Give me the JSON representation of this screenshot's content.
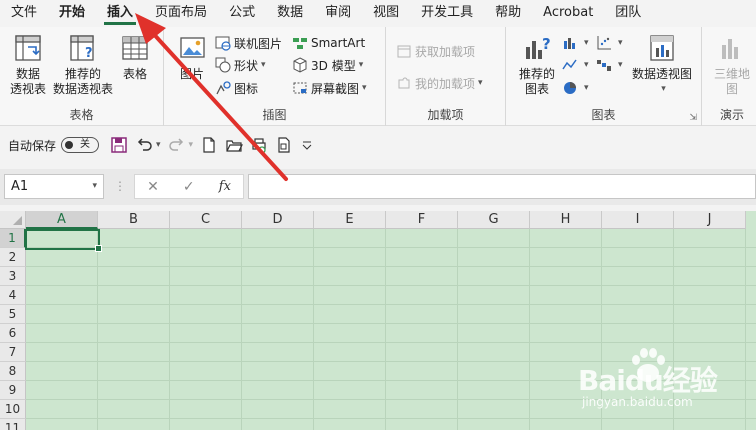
{
  "tabs": [
    {
      "label": "文件",
      "state": "normal"
    },
    {
      "label": "开始",
      "state": "bold"
    },
    {
      "label": "插入",
      "state": "active"
    },
    {
      "label": "页面布局",
      "state": "normal"
    },
    {
      "label": "公式",
      "state": "normal"
    },
    {
      "label": "数据",
      "state": "normal"
    },
    {
      "label": "审阅",
      "state": "normal"
    },
    {
      "label": "视图",
      "state": "normal"
    },
    {
      "label": "开发工具",
      "state": "normal"
    },
    {
      "label": "帮助",
      "state": "normal"
    },
    {
      "label": "Acrobat",
      "state": "normal"
    },
    {
      "label": "团队",
      "state": "normal"
    }
  ],
  "ribbon": {
    "tables": {
      "group_label": "表格",
      "pivot_line1": "数据",
      "pivot_line2": "透视表",
      "recommended_line1": "推荐的",
      "recommended_line2": "数据透视表",
      "table": "表格"
    },
    "illustrations": {
      "group_label": "插图",
      "picture": "图片",
      "online_picture": "联机图片",
      "shapes": "形状",
      "icons": "图标",
      "smartart": "SmartArt",
      "model3d": "3D 模型",
      "screenshot": "屏幕截图"
    },
    "addins": {
      "group_label": "加载项",
      "get_addins": "获取加载项",
      "my_addins": "我的加载项"
    },
    "charts": {
      "group_label": "图表",
      "recommended_line1": "推荐的",
      "recommended_line2": "图表",
      "pivot_chart": "数据透视图"
    },
    "tours": {
      "group_label": "演示",
      "map3d_line1": "三维地",
      "map3d_line2": "图"
    }
  },
  "qat": {
    "autosave_label": "自动保存",
    "autosave_state": "关"
  },
  "formula_bar": {
    "name_box": "A1",
    "fx": "fx",
    "formula": ""
  },
  "grid": {
    "columns": [
      "A",
      "B",
      "C",
      "D",
      "E",
      "F",
      "G",
      "H",
      "I",
      "J"
    ],
    "rows": [
      "1",
      "2",
      "3",
      "4",
      "5",
      "6",
      "7",
      "8",
      "9",
      "10",
      "11"
    ],
    "selected_cell": "A1"
  },
  "watermark": {
    "brand": "Baidu经验",
    "url": "jingyan.baidu.com"
  },
  "colors": {
    "excel_green": "#217346",
    "arrow_red": "#e0312b",
    "eye_protection_green": "#cde6cf"
  }
}
